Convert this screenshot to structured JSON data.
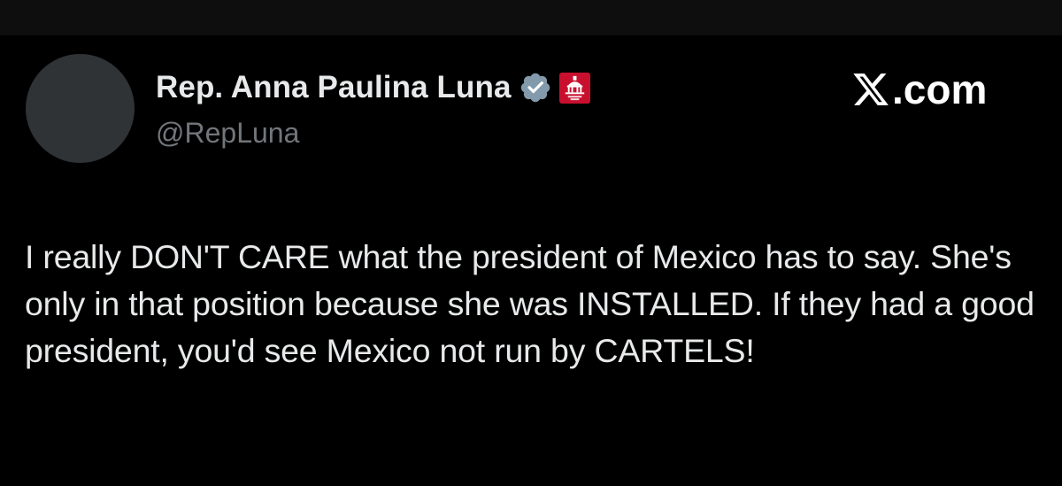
{
  "author": {
    "display_name": "Rep. Anna Paulina Luna",
    "handle": "@RepLuna",
    "badges": [
      "verified-gray-icon",
      "house-gop-affiliate-icon"
    ]
  },
  "watermark": {
    "text": ".com",
    "logo_icon": "x-logo-icon"
  },
  "tweet": {
    "text": "I really DON'T CARE what the president of Mexico has to say. She's only in that position because she was INSTALLED. If they had a good president, you'd see Mexico not run by CARTELS!"
  },
  "colors": {
    "background": "#000000",
    "top_bar": "#0e0e0e",
    "primary_text": "#e7e9ea",
    "secondary_text": "#71767b",
    "avatar_placeholder": "#2f3336",
    "verified_badge": "#829aab",
    "affiliate_badge": "#c8102e"
  }
}
